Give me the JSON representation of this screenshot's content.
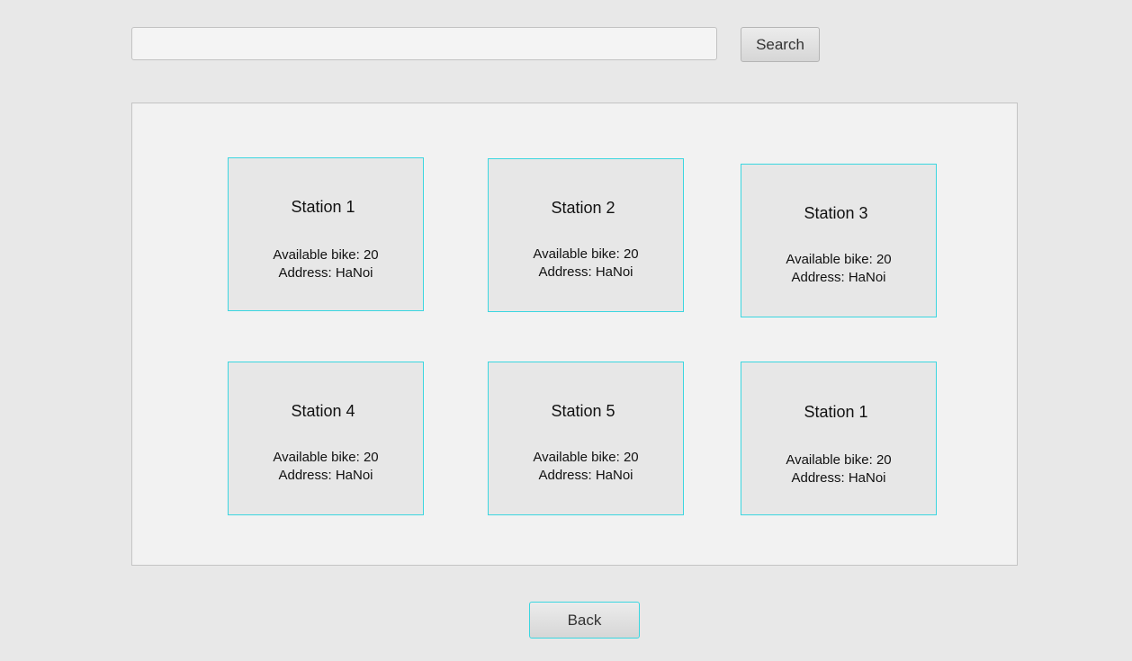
{
  "search": {
    "value": "",
    "placeholder": "",
    "button_label": "Search"
  },
  "stations": [
    {
      "name": "Station 1",
      "available": "Available bike: 20",
      "address": "Address: HaNoi"
    },
    {
      "name": "Station 2",
      "available": "Available bike: 20",
      "address": "Address: HaNoi"
    },
    {
      "name": "Station 3",
      "available": "Available bike: 20",
      "address": "Address: HaNoi"
    },
    {
      "name": "Station 4",
      "available": "Available bike: 20",
      "address": "Address: HaNoi"
    },
    {
      "name": "Station 5",
      "available": "Available bike: 20",
      "address": "Address: HaNoi"
    },
    {
      "name": "Station 1",
      "available": "Available bike: 20",
      "address": "Address: HaNoi"
    }
  ],
  "footer": {
    "back_label": "Back"
  },
  "colors": {
    "background": "#e8e8e8",
    "panel": "#f2f2f2",
    "card": "#e7e7e7",
    "card_border": "#3bd6e0"
  }
}
